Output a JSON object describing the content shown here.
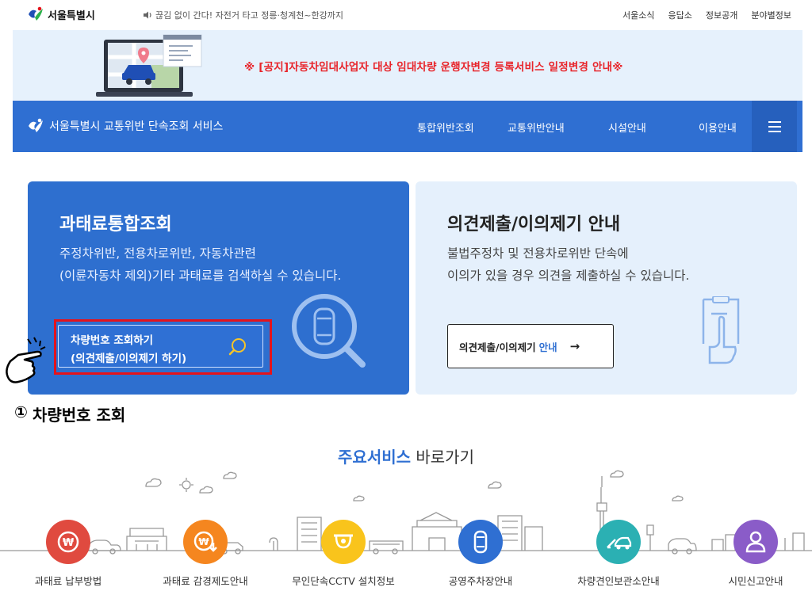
{
  "header": {
    "logo_text": "서울특별시",
    "ticker_text": "끊김 없이 간다! 자전거 타고 정릉·청계천~한강까지",
    "links": [
      "서울소식",
      "응답소",
      "정보공개",
      "분야별정보"
    ]
  },
  "notice": {
    "text": "※ [공지]자동차임대사업자 대상 임대차량 운행자변경 등록서비스 일정변경 안내※"
  },
  "nav": {
    "service_title": "서울특별시 교통위반 단속조회 서비스",
    "items": [
      "통합위반조회",
      "교통위반안내",
      "시설안내",
      "이용안내"
    ]
  },
  "card_left": {
    "title": "과태료통합조회",
    "desc_line1": "주정차위반, 전용차로위반, 자동차관련",
    "desc_line2": "(이륜자동차 제외)기타 과태료를 검색하실 수 있습니다.",
    "button_line1": "차량번호 조회하기",
    "button_line2": "(의견제출/이의제기 하기)"
  },
  "card_right": {
    "title": "의견제출/이의제기 안내",
    "desc_line1": "불법주정차 및 전용차로위반 단속에",
    "desc_line2": "이의가 있을 경우 의견을 제출하실 수 있습니다.",
    "button_text": "의견제출/이의제기",
    "button_highlight": "안내",
    "button_arrow": "→"
  },
  "step": {
    "number": "①",
    "label": "차량번호 조회"
  },
  "section": {
    "title_bold": "주요서비스",
    "title_rest": "바로가기"
  },
  "services": [
    {
      "label": "과태료 납부방법",
      "color": "#e04a3f",
      "icon": "won-coin-icon"
    },
    {
      "label": "과태료 감경제도안내",
      "color": "#f5861f",
      "icon": "won-down-icon"
    },
    {
      "label": "무인단속CCTV 설치정보",
      "color": "#f9c41c",
      "icon": "cctv-icon"
    },
    {
      "label": "공영주차장안내",
      "color": "#2f6fd2",
      "icon": "car-top-icon"
    },
    {
      "label": "차량견인보관소안내",
      "color": "#2bb0b3",
      "icon": "tow-truck-icon"
    },
    {
      "label": "시민신고안내",
      "color": "#8a5cc8",
      "icon": "person-icon"
    }
  ],
  "colors": {
    "primary": "#2f6fd2",
    "notice_red": "#e8242a",
    "light_blue": "#e5f0fc"
  }
}
